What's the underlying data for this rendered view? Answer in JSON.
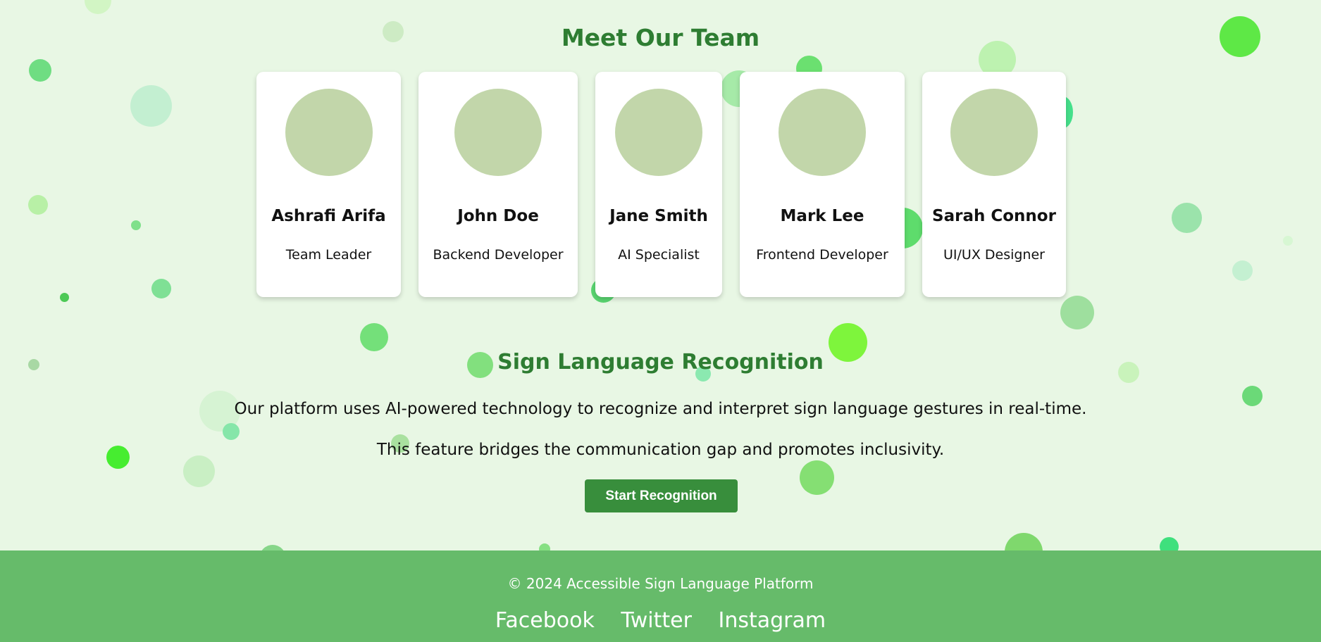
{
  "colors": {
    "background": "#e8f7e4",
    "heading": "#2e7d32",
    "button": "#388e3c",
    "footer": "#66bb6a",
    "avatar": "#c2d6aa"
  },
  "team": {
    "title": "Meet Our Team",
    "members": [
      {
        "name": "Ashrafi Arifa",
        "role": "Team Leader"
      },
      {
        "name": "John Doe",
        "role": "Backend Developer"
      },
      {
        "name": "Jane Smith",
        "role": "AI Specialist"
      },
      {
        "name": "Mark Lee",
        "role": "Frontend Developer"
      },
      {
        "name": "Sarah Connor",
        "role": "UI/UX Designer"
      }
    ]
  },
  "recognition": {
    "title": "Sign Language Recognition",
    "description_1": "Our platform uses AI-powered technology to recognize and interpret sign language gestures in real-time.",
    "description_2": "This feature bridges the communication gap and promotes inclusivity.",
    "button_label": "Start Recognition"
  },
  "footer": {
    "copyright": "© 2024 Accessible Sign Language Platform",
    "links": [
      "Facebook",
      "Twitter",
      "Instagram"
    ]
  }
}
